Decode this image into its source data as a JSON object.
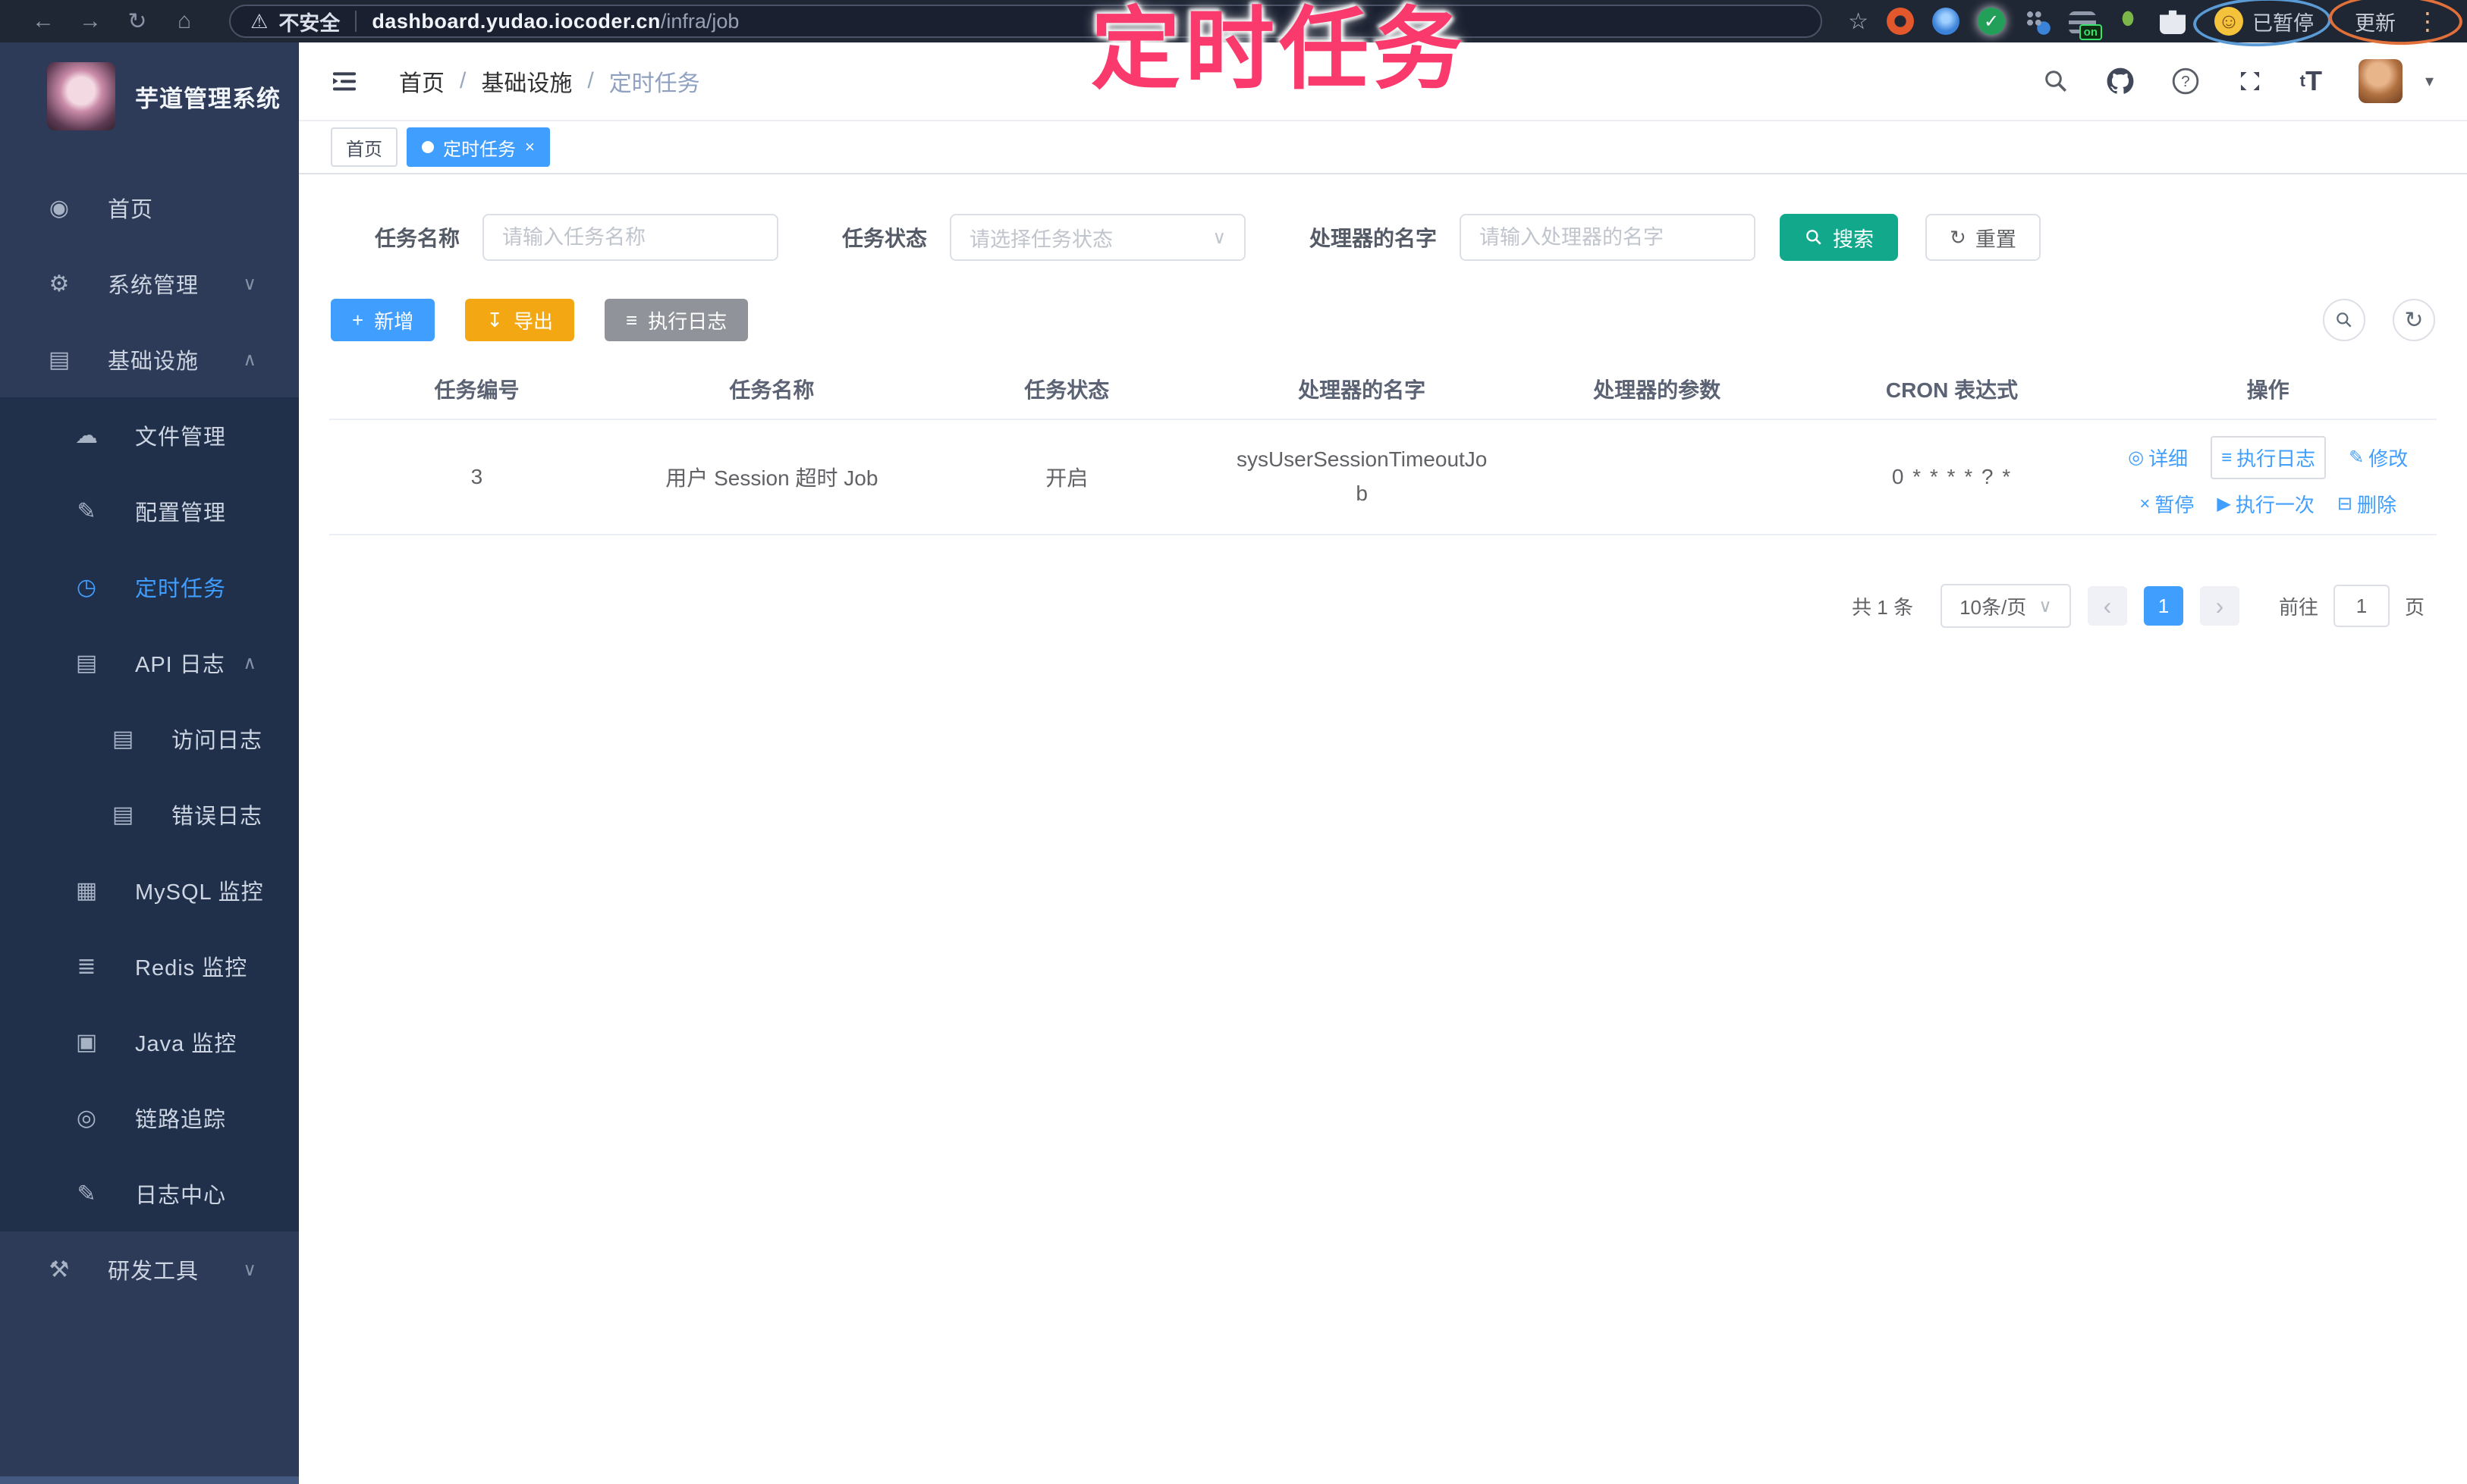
{
  "browser": {
    "security_warning": "不安全",
    "url_host": "dashboard.yudao.iocoder.cn",
    "url_path": "/infra/job",
    "profile_label": "已暂停",
    "update_label": "更新",
    "extension_badge": "on"
  },
  "annotation": {
    "title": "定时任务",
    "color": "#fa3a6c"
  },
  "glyphs": {
    "back": "←",
    "forward": "→",
    "reload": "↻",
    "home": "⌂",
    "warning": "⚠",
    "star": "☆",
    "dots": "⋮",
    "smiley": "☺",
    "caret_down": "▾",
    "select_caret": "∨",
    "prev": "‹",
    "next": "›",
    "plus": "+",
    "download": "↧",
    "list": "≡",
    "refresh": "↻",
    "font_small": "t",
    "font_big": "T"
  },
  "sidebar": {
    "app_title": "芋道管理系统",
    "items": [
      {
        "label": "首页",
        "glyph": "◉"
      },
      {
        "label": "系统管理",
        "glyph": "⚙",
        "chevron": "∨"
      },
      {
        "label": "基础设施",
        "glyph": "▤",
        "chevron": "∧"
      },
      {
        "label": "文件管理",
        "glyph": "☁"
      },
      {
        "label": "配置管理",
        "glyph": "✎"
      },
      {
        "label": "定时任务",
        "glyph": "◷"
      },
      {
        "label": "API 日志",
        "glyph": "▤",
        "chevron": "∧"
      },
      {
        "label": "访问日志",
        "glyph": "▤"
      },
      {
        "label": "错误日志",
        "glyph": "▤"
      },
      {
        "label": "MySQL 监控",
        "glyph": "▦"
      },
      {
        "label": "Redis 监控",
        "glyph": "≣"
      },
      {
        "label": "Java 监控",
        "glyph": "▣"
      },
      {
        "label": "链路追踪",
        "glyph": "◎"
      },
      {
        "label": "日志中心",
        "glyph": "✎"
      },
      {
        "label": "研发工具",
        "glyph": "⚒",
        "chevron": "∨"
      }
    ]
  },
  "header": {
    "breadcrumb": {
      "home": "首页",
      "section": "基础设施",
      "current": "定时任务"
    },
    "separator": "/"
  },
  "tags": {
    "home": "首页",
    "current": "定时任务",
    "close": "×"
  },
  "filters": {
    "name_label": "任务名称",
    "name_placeholder": "请输入任务名称",
    "status_label": "任务状态",
    "status_placeholder": "请选择任务状态",
    "handler_label": "处理器的名字",
    "handler_placeholder": "请输入处理器的名字",
    "search_label": "搜索",
    "reset_label": "重置"
  },
  "toolbar": {
    "add_label": "新增",
    "export_label": "导出",
    "exec_log_label": "执行日志"
  },
  "table": {
    "headers": [
      "任务编号",
      "任务名称",
      "任务状态",
      "处理器的名字",
      "处理器的参数",
      "CRON 表达式",
      "操作"
    ],
    "row": {
      "id": "3",
      "name": "用户 Session 超时 Job",
      "status": "开启",
      "handler": "sysUserSessionTimeoutJob",
      "param": "",
      "cron": "0 * * * * ? *"
    },
    "actions_top": [
      {
        "glyph": "◎",
        "label": "详细"
      },
      {
        "glyph": "≡",
        "label": "执行日志"
      },
      {
        "glyph": "✎",
        "label": "修改"
      }
    ],
    "actions_bottom": [
      {
        "glyph": "×",
        "label": "暂停"
      },
      {
        "glyph": "▶",
        "label": "执行一次"
      },
      {
        "glyph": "⊟",
        "label": "删除"
      }
    ]
  },
  "pagination": {
    "total": "共 1 条",
    "page_size": "10条/页",
    "page": "1",
    "goto_label": "前往",
    "goto_value": "1",
    "unit_label": "页"
  },
  "colors": {
    "primary": "#409eff",
    "search_teal": "#11a88c",
    "export_yellow": "#f2a713",
    "info_gray": "#909399",
    "annotation_pink": "#fa3a6c",
    "sidebar_bg": "#2d3b58",
    "submenu_bg": "#20304b",
    "browser_bg": "#1f2634"
  }
}
